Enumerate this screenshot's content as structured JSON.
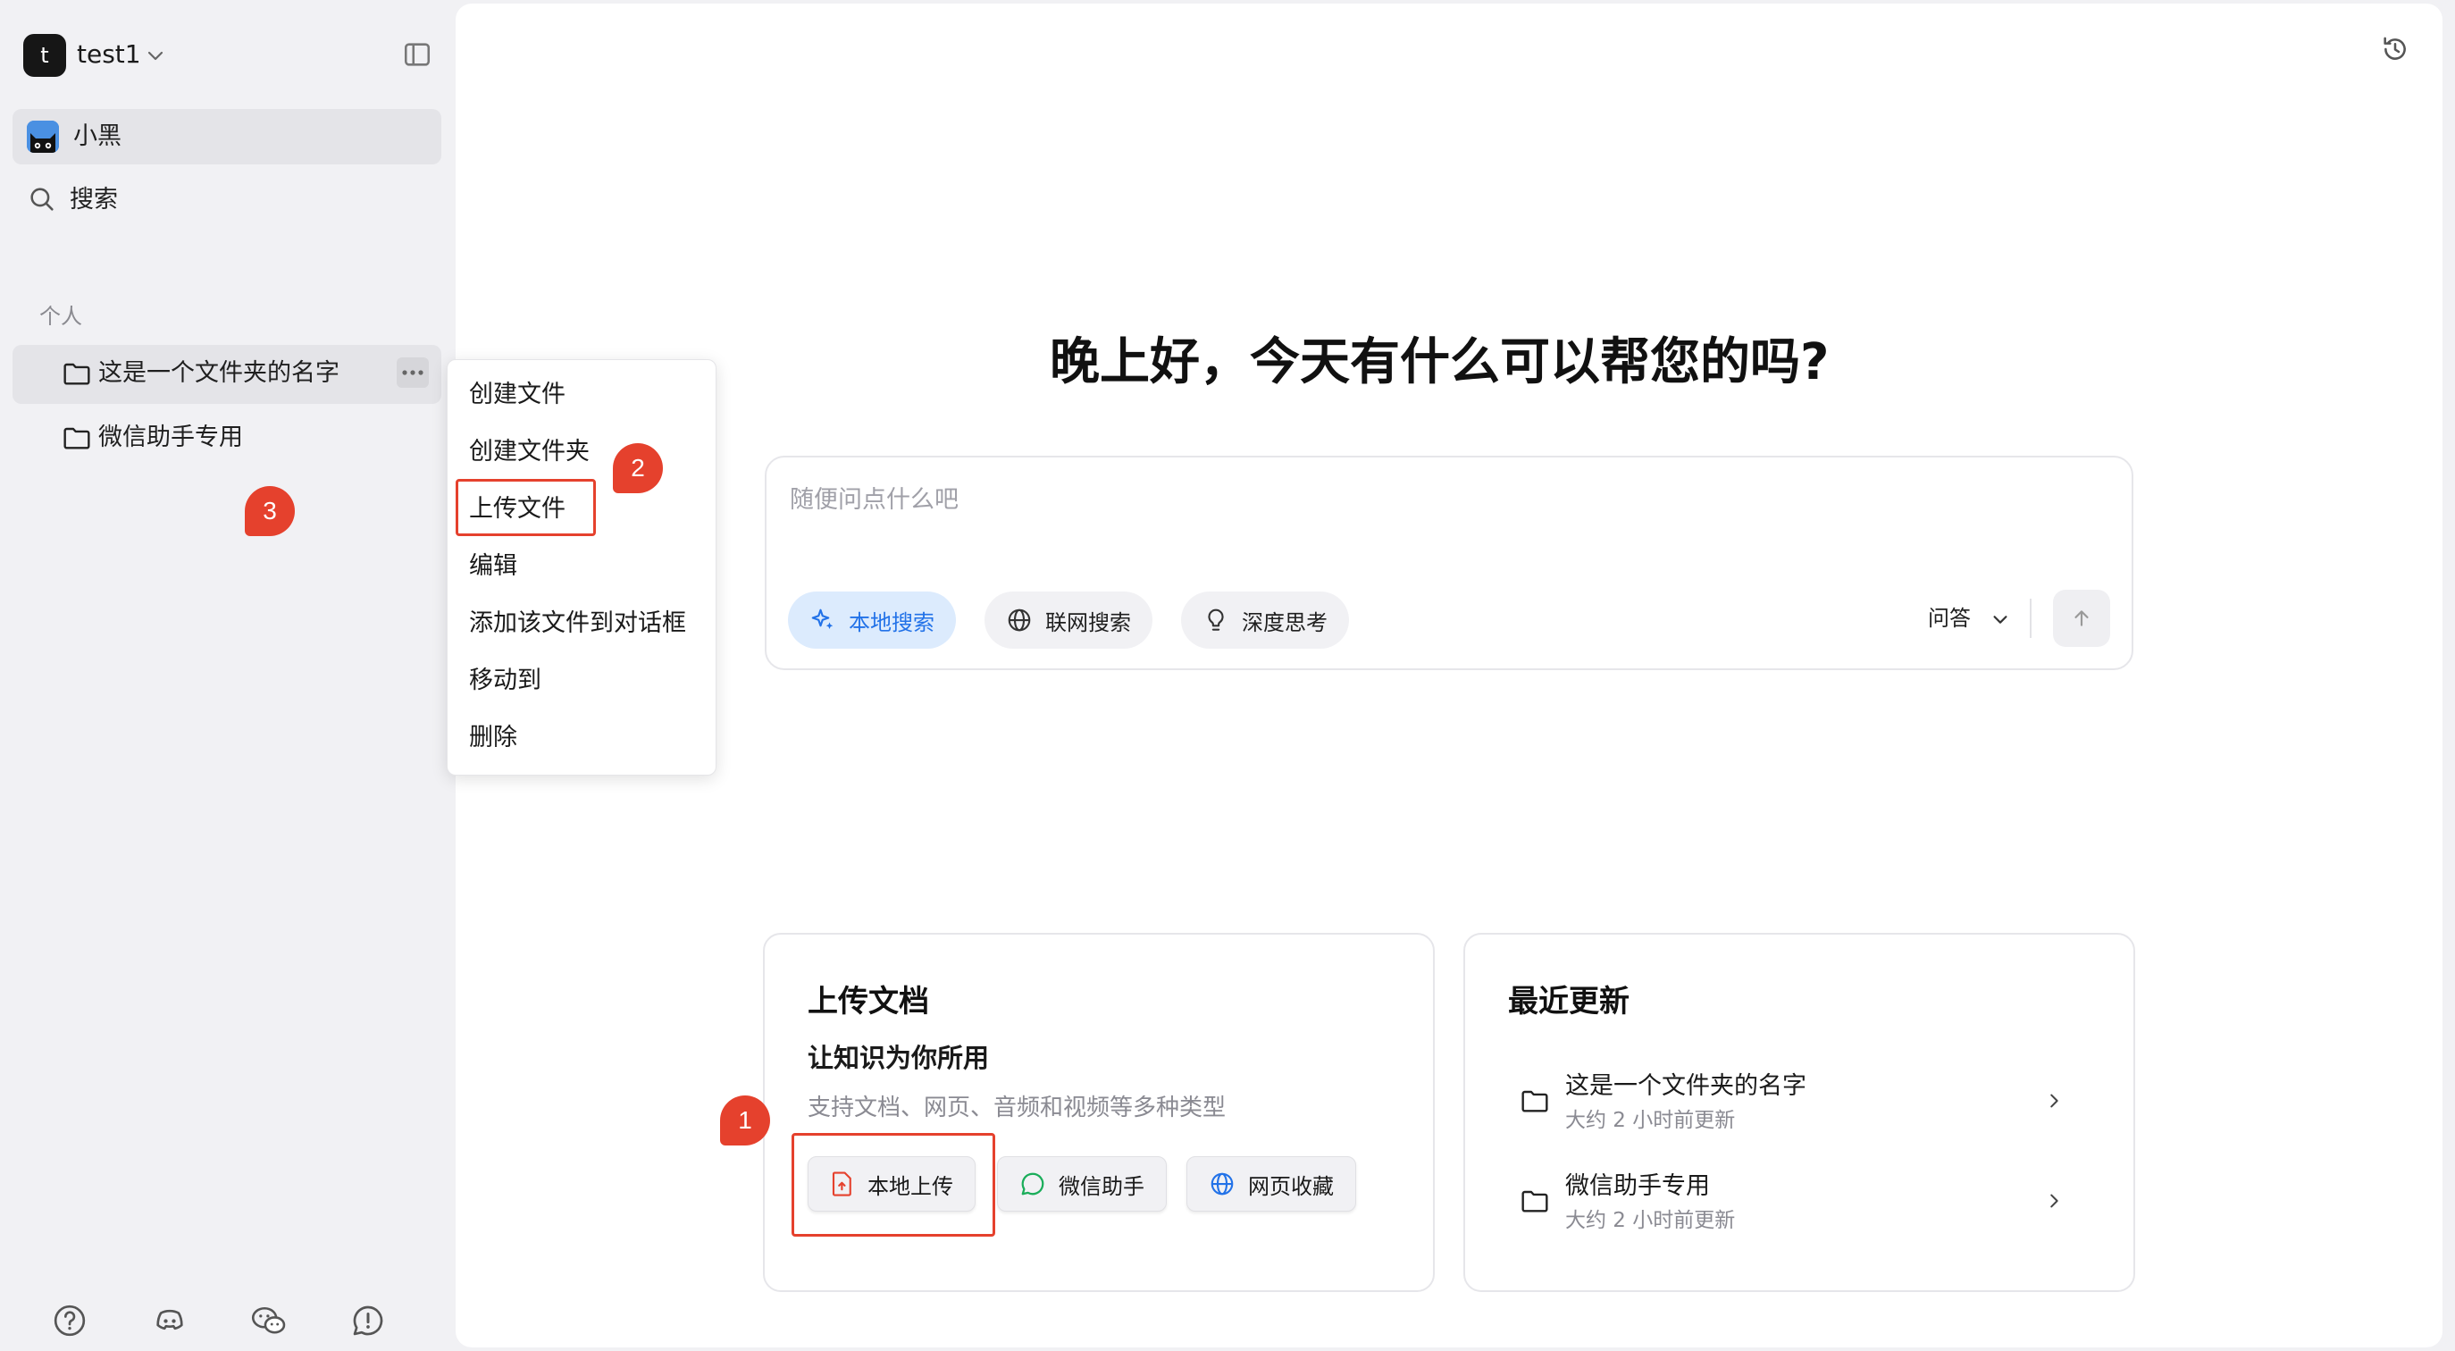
{
  "workspace": {
    "avatar_letter": "t",
    "name": "test1"
  },
  "sidebar": {
    "agent_label": "小黑",
    "search_label": "搜索",
    "section_label": "个人",
    "folders": [
      {
        "name": "这是一个文件夹的名字"
      },
      {
        "name": "微信助手专用"
      }
    ],
    "footer_icons": [
      "help-icon",
      "discord-icon",
      "wechat-icon",
      "feedback-icon"
    ]
  },
  "context_menu": {
    "items": [
      "创建文件",
      "创建文件夹",
      "上传文件",
      "编辑",
      "添加该文件到对话框",
      "移动到",
      "删除"
    ],
    "highlighted": "上传文件"
  },
  "badges": [
    "1",
    "2",
    "3"
  ],
  "main": {
    "greeting": "晚上好，今天有什么可以帮您的吗?",
    "chat": {
      "placeholder": "随便问点什么吧",
      "tools": [
        {
          "label": "本地搜索",
          "icon": "sparkle-icon",
          "active": true
        },
        {
          "label": "联网搜索",
          "icon": "globe-icon",
          "active": false
        },
        {
          "label": "深度思考",
          "icon": "lightbulb-icon",
          "active": false
        }
      ],
      "mode": "问答"
    },
    "upload_card": {
      "title": "上传文档",
      "subtitle": "让知识为你所用",
      "description": "支持文档、网页、音频和视频等多种类型",
      "buttons": [
        {
          "label": "本地上传",
          "icon": "file-upload-icon"
        },
        {
          "label": "微信助手",
          "icon": "chat-bubble-icon"
        },
        {
          "label": "网页收藏",
          "icon": "globe-icon"
        }
      ]
    },
    "recent_card": {
      "title": "最近更新",
      "items": [
        {
          "name": "这是一个文件夹的名字",
          "time": "大约 2 小时前更新"
        },
        {
          "name": "微信助手专用",
          "time": "大约 2 小时前更新"
        }
      ]
    }
  },
  "colors": {
    "accent_red": "#e5412d",
    "active_blue": "#2272e8",
    "active_blue_bg": "#dcebfd",
    "sidebar_bg": "#f1f1f4"
  }
}
